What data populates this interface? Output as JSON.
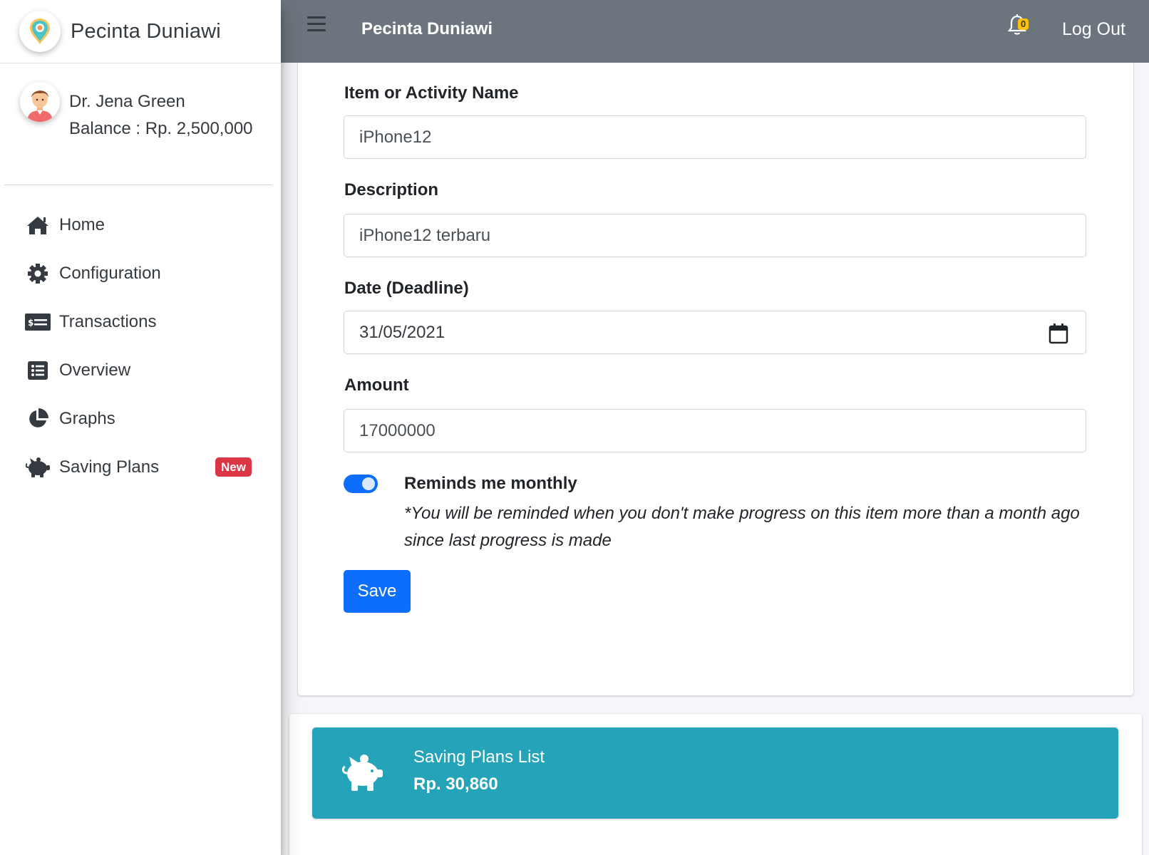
{
  "brand": {
    "name": "Pecinta Duniawi",
    "logo_icon": "map-pin-logo-icon"
  },
  "user": {
    "name": "Dr. Jena Green",
    "balance": "Balance : Rp. 2,500,000"
  },
  "nav": [
    {
      "label": "Home",
      "icon": "home-icon"
    },
    {
      "label": "Configuration",
      "icon": "gear-icon"
    },
    {
      "label": "Transactions",
      "icon": "money-check-icon"
    },
    {
      "label": "Overview",
      "icon": "list-icon"
    },
    {
      "label": "Graphs",
      "icon": "pie-chart-icon"
    },
    {
      "label": "Saving Plans",
      "icon": "piggy-bank-icon",
      "badge": "New"
    }
  ],
  "topbar": {
    "title": "Pecinta Duniawi",
    "notifications": "0",
    "logout": "Log Out"
  },
  "form": {
    "item_label": "Item or Activity Name",
    "item_value": "iPhone12",
    "description_label": "Description",
    "description_value": "iPhone12 terbaru",
    "date_label": "Date (Deadline)",
    "date_value": "31/05/2021",
    "amount_label": "Amount",
    "amount_value": "17000000",
    "remind_enabled": true,
    "remind_title": "Reminds me monthly",
    "remind_note": "*You will be reminded when you don't make progress on this item more than a month ago since last progress is made",
    "save_label": "Save"
  },
  "saving_plans": {
    "title": "Saving Plans List",
    "amount": "Rp. 30,860"
  },
  "colors": {
    "topbar": "#6c757d",
    "primary": "#0d6efd",
    "info": "#25a3b8",
    "danger_badge": "#dc3545",
    "warning_badge": "#ffc107"
  }
}
